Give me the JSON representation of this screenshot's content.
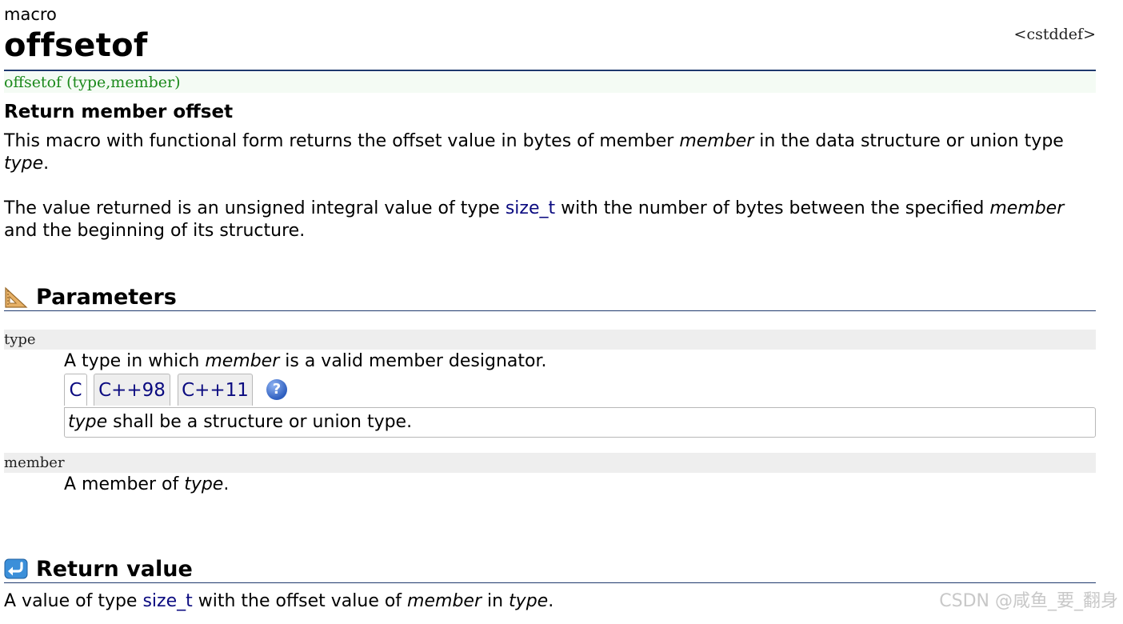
{
  "header": {
    "kind": "macro",
    "title": "offsetof",
    "include": "<cstddef>"
  },
  "prototype": "offsetof (type,member)",
  "subtitle": "Return member offset",
  "description": {
    "p1_a": "This macro with functional form returns the offset value in bytes of member ",
    "p1_member": "member",
    "p1_b": " in the data structure or union type ",
    "p1_type": "type",
    "p1_c": ".",
    "p2_a": "The value returned is an unsigned integral value of type ",
    "p2_link": "size_t",
    "p2_b": " with the number of bytes between the specified ",
    "p2_member": "member",
    "p2_c": " and the beginning of its structure."
  },
  "parameters": {
    "heading": "Parameters",
    "icon": "set-square-icon",
    "items": [
      {
        "name": "type",
        "desc_a": "A type in which ",
        "desc_em": "member",
        "desc_b": " is a valid member designator.",
        "tabs": [
          "C",
          "C++98",
          "C++11"
        ],
        "active_tab": "C",
        "help_icon": "?",
        "panel_em": "type",
        "panel_text": " shall be a structure or union type."
      },
      {
        "name": "member",
        "desc_a": "A member of ",
        "desc_em": "type",
        "desc_b": "."
      }
    ]
  },
  "return_value": {
    "heading": "Return value",
    "icon": "return-arrow-icon",
    "text_a": "A value of type ",
    "link": "size_t",
    "text_b": " with the offset value of ",
    "em1": "member",
    "text_c": " in ",
    "em2": "type",
    "text_d": "."
  },
  "watermark": "CSDN @咸鱼_要_翻身",
  "colors": {
    "link": "#0b0b80",
    "prototype": "#1c8a1c",
    "rule": "#1f3a6e"
  }
}
